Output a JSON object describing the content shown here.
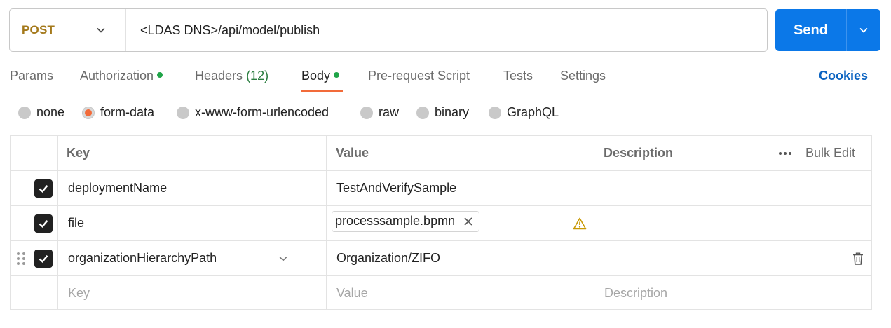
{
  "request": {
    "method": "POST",
    "url": "<LDAS DNS>/api/model/publish",
    "send_label": "Send"
  },
  "tabs": [
    {
      "label": "Params",
      "active": false
    },
    {
      "label": "Authorization",
      "active": false,
      "dot": true
    },
    {
      "label": "Headers",
      "count": "(12)",
      "active": false
    },
    {
      "label": "Body",
      "active": true,
      "dot": true
    },
    {
      "label": "Pre-request Script",
      "active": false
    },
    {
      "label": "Tests",
      "active": false
    },
    {
      "label": "Settings",
      "active": false
    }
  ],
  "cookies_label": "Cookies",
  "body_types": [
    {
      "label": "none",
      "selected": false
    },
    {
      "label": "form-data",
      "selected": true
    },
    {
      "label": "x-www-form-urlencoded",
      "selected": false
    },
    {
      "label": "raw",
      "selected": false
    },
    {
      "label": "binary",
      "selected": false
    },
    {
      "label": "GraphQL",
      "selected": false
    }
  ],
  "table": {
    "headers": {
      "key": "Key",
      "value": "Value",
      "description": "Description",
      "bulk_edit": "Bulk Edit"
    },
    "rows": [
      {
        "checked": true,
        "key": "deploymentName",
        "value": "TestAndVerifySample",
        "description": ""
      },
      {
        "checked": true,
        "key": "file",
        "value_file": "processsample.bpmn",
        "warning": true,
        "description": ""
      },
      {
        "checked": true,
        "key": "organizationHierarchyPath",
        "value": "Organization/ZIFO",
        "description": ""
      }
    ],
    "new_row": {
      "key_placeholder": "Key",
      "value_placeholder": "Value",
      "description_placeholder": "Description"
    }
  },
  "colors": {
    "method": "#a4791b",
    "send_button": "#0b78e8",
    "active_tab_underline": "#f26b3a",
    "status_dot": "#1fa448",
    "cookies_link": "#0b63c1",
    "warning": "#c99a06"
  }
}
